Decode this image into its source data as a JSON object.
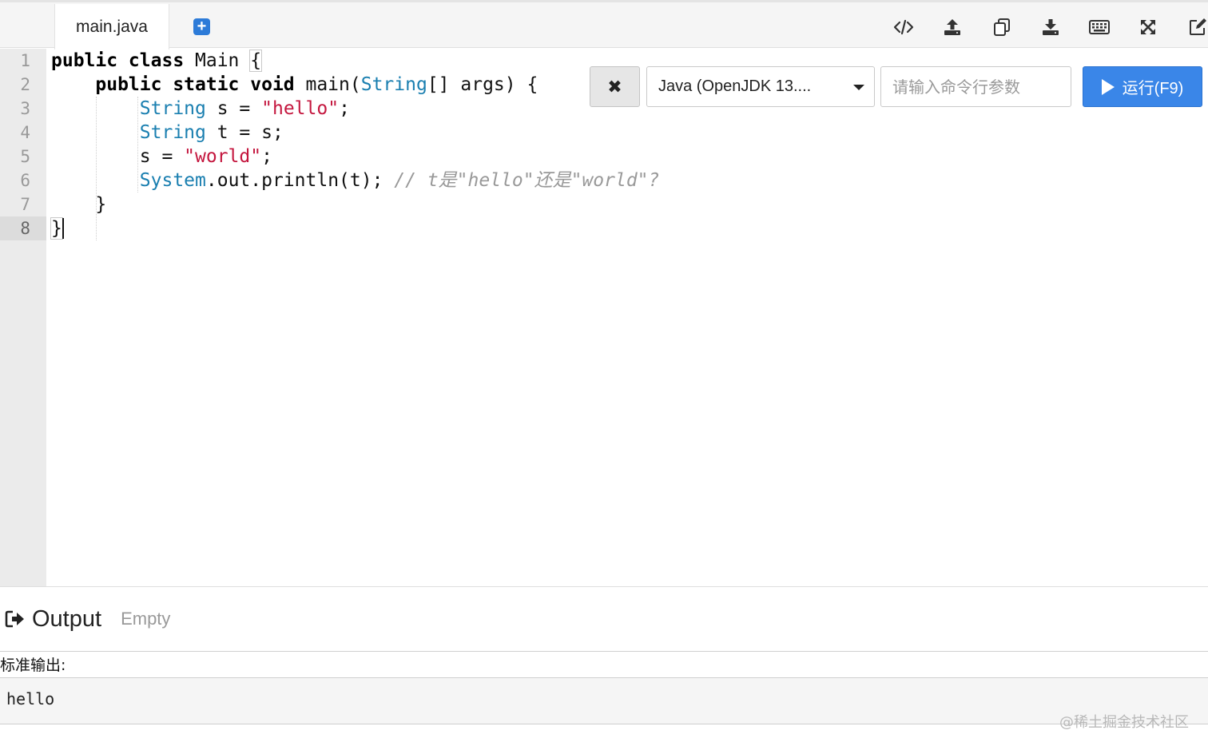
{
  "tabs": [
    {
      "label": "main.java",
      "active": true
    }
  ],
  "toolbar": {
    "icons": [
      "code-icon",
      "upload-icon",
      "copy-icon",
      "download-icon",
      "keyboard-icon",
      "fullscreen-icon",
      "edit-icon"
    ]
  },
  "editor": {
    "line_numbers": [
      "1",
      "2",
      "3",
      "4",
      "5",
      "6",
      "7",
      "8"
    ],
    "active_line": 8,
    "lines": [
      [
        {
          "t": "public class",
          "c": "kw"
        },
        {
          "t": " Main "
        },
        {
          "t": "{",
          "c": "br"
        }
      ],
      [
        {
          "t": "    "
        },
        {
          "t": "public static void",
          "c": "kw"
        },
        {
          "t": " main("
        },
        {
          "t": "String",
          "c": "ty"
        },
        {
          "t": "[] args) {"
        }
      ],
      [
        {
          "t": "        "
        },
        {
          "t": "String",
          "c": "ty"
        },
        {
          "t": " s = "
        },
        {
          "t": "\"hello\"",
          "c": "st"
        },
        {
          "t": ";"
        }
      ],
      [
        {
          "t": "        "
        },
        {
          "t": "String",
          "c": "ty"
        },
        {
          "t": " t = s;"
        }
      ],
      [
        {
          "t": "        s = "
        },
        {
          "t": "\"world\"",
          "c": "st"
        },
        {
          "t": ";"
        }
      ],
      [
        {
          "t": "        "
        },
        {
          "t": "System",
          "c": "ty"
        },
        {
          "t": ".out.println(t); "
        },
        {
          "t": "// t是\"hello\"还是\"world\"?",
          "c": "cm"
        }
      ],
      [
        {
          "t": "    }"
        }
      ],
      [
        {
          "t": "}",
          "c": "br"
        }
      ]
    ]
  },
  "run_controls": {
    "clear_label": "✖",
    "language_selected": "Java (OpenJDK 13....",
    "args_placeholder": "请输入命令行参数",
    "args_value": "",
    "run_label": "运行(F9)"
  },
  "output": {
    "title": "Output",
    "status": "Empty",
    "stdout_label": "标准输出:",
    "stdout_text": "hello"
  },
  "watermark": "@稀土掘金技术社区",
  "colors": {
    "run_button": "#3a86e8",
    "keyword": "#000000",
    "type": "#1a7fb0",
    "string": "#c4163e",
    "comment": "#999999"
  }
}
